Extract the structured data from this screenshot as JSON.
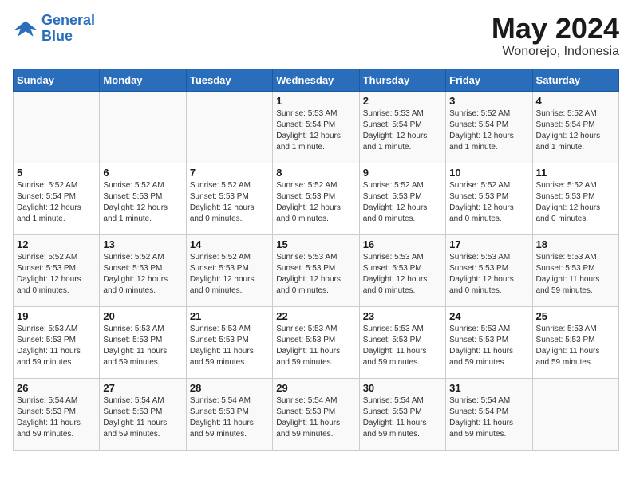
{
  "header": {
    "logo_general": "General",
    "logo_blue": "Blue",
    "month_year": "May 2024",
    "location": "Wonorejo, Indonesia"
  },
  "days_of_week": [
    "Sunday",
    "Monday",
    "Tuesday",
    "Wednesday",
    "Thursday",
    "Friday",
    "Saturday"
  ],
  "weeks": [
    [
      {
        "day": "",
        "info": ""
      },
      {
        "day": "",
        "info": ""
      },
      {
        "day": "",
        "info": ""
      },
      {
        "day": "1",
        "info": "Sunrise: 5:53 AM\nSunset: 5:54 PM\nDaylight: 12 hours\nand 1 minute."
      },
      {
        "day": "2",
        "info": "Sunrise: 5:53 AM\nSunset: 5:54 PM\nDaylight: 12 hours\nand 1 minute."
      },
      {
        "day": "3",
        "info": "Sunrise: 5:52 AM\nSunset: 5:54 PM\nDaylight: 12 hours\nand 1 minute."
      },
      {
        "day": "4",
        "info": "Sunrise: 5:52 AM\nSunset: 5:54 PM\nDaylight: 12 hours\nand 1 minute."
      }
    ],
    [
      {
        "day": "5",
        "info": "Sunrise: 5:52 AM\nSunset: 5:54 PM\nDaylight: 12 hours\nand 1 minute."
      },
      {
        "day": "6",
        "info": "Sunrise: 5:52 AM\nSunset: 5:53 PM\nDaylight: 12 hours\nand 1 minute."
      },
      {
        "day": "7",
        "info": "Sunrise: 5:52 AM\nSunset: 5:53 PM\nDaylight: 12 hours\nand 0 minutes."
      },
      {
        "day": "8",
        "info": "Sunrise: 5:52 AM\nSunset: 5:53 PM\nDaylight: 12 hours\nand 0 minutes."
      },
      {
        "day": "9",
        "info": "Sunrise: 5:52 AM\nSunset: 5:53 PM\nDaylight: 12 hours\nand 0 minutes."
      },
      {
        "day": "10",
        "info": "Sunrise: 5:52 AM\nSunset: 5:53 PM\nDaylight: 12 hours\nand 0 minutes."
      },
      {
        "day": "11",
        "info": "Sunrise: 5:52 AM\nSunset: 5:53 PM\nDaylight: 12 hours\nand 0 minutes."
      }
    ],
    [
      {
        "day": "12",
        "info": "Sunrise: 5:52 AM\nSunset: 5:53 PM\nDaylight: 12 hours\nand 0 minutes."
      },
      {
        "day": "13",
        "info": "Sunrise: 5:52 AM\nSunset: 5:53 PM\nDaylight: 12 hours\nand 0 minutes."
      },
      {
        "day": "14",
        "info": "Sunrise: 5:52 AM\nSunset: 5:53 PM\nDaylight: 12 hours\nand 0 minutes."
      },
      {
        "day": "15",
        "info": "Sunrise: 5:53 AM\nSunset: 5:53 PM\nDaylight: 12 hours\nand 0 minutes."
      },
      {
        "day": "16",
        "info": "Sunrise: 5:53 AM\nSunset: 5:53 PM\nDaylight: 12 hours\nand 0 minutes."
      },
      {
        "day": "17",
        "info": "Sunrise: 5:53 AM\nSunset: 5:53 PM\nDaylight: 12 hours\nand 0 minutes."
      },
      {
        "day": "18",
        "info": "Sunrise: 5:53 AM\nSunset: 5:53 PM\nDaylight: 11 hours\nand 59 minutes."
      }
    ],
    [
      {
        "day": "19",
        "info": "Sunrise: 5:53 AM\nSunset: 5:53 PM\nDaylight: 11 hours\nand 59 minutes."
      },
      {
        "day": "20",
        "info": "Sunrise: 5:53 AM\nSunset: 5:53 PM\nDaylight: 11 hours\nand 59 minutes."
      },
      {
        "day": "21",
        "info": "Sunrise: 5:53 AM\nSunset: 5:53 PM\nDaylight: 11 hours\nand 59 minutes."
      },
      {
        "day": "22",
        "info": "Sunrise: 5:53 AM\nSunset: 5:53 PM\nDaylight: 11 hours\nand 59 minutes."
      },
      {
        "day": "23",
        "info": "Sunrise: 5:53 AM\nSunset: 5:53 PM\nDaylight: 11 hours\nand 59 minutes."
      },
      {
        "day": "24",
        "info": "Sunrise: 5:53 AM\nSunset: 5:53 PM\nDaylight: 11 hours\nand 59 minutes."
      },
      {
        "day": "25",
        "info": "Sunrise: 5:53 AM\nSunset: 5:53 PM\nDaylight: 11 hours\nand 59 minutes."
      }
    ],
    [
      {
        "day": "26",
        "info": "Sunrise: 5:54 AM\nSunset: 5:53 PM\nDaylight: 11 hours\nand 59 minutes."
      },
      {
        "day": "27",
        "info": "Sunrise: 5:54 AM\nSunset: 5:53 PM\nDaylight: 11 hours\nand 59 minutes."
      },
      {
        "day": "28",
        "info": "Sunrise: 5:54 AM\nSunset: 5:53 PM\nDaylight: 11 hours\nand 59 minutes."
      },
      {
        "day": "29",
        "info": "Sunrise: 5:54 AM\nSunset: 5:53 PM\nDaylight: 11 hours\nand 59 minutes."
      },
      {
        "day": "30",
        "info": "Sunrise: 5:54 AM\nSunset: 5:53 PM\nDaylight: 11 hours\nand 59 minutes."
      },
      {
        "day": "31",
        "info": "Sunrise: 5:54 AM\nSunset: 5:54 PM\nDaylight: 11 hours\nand 59 minutes."
      },
      {
        "day": "",
        "info": ""
      }
    ]
  ]
}
